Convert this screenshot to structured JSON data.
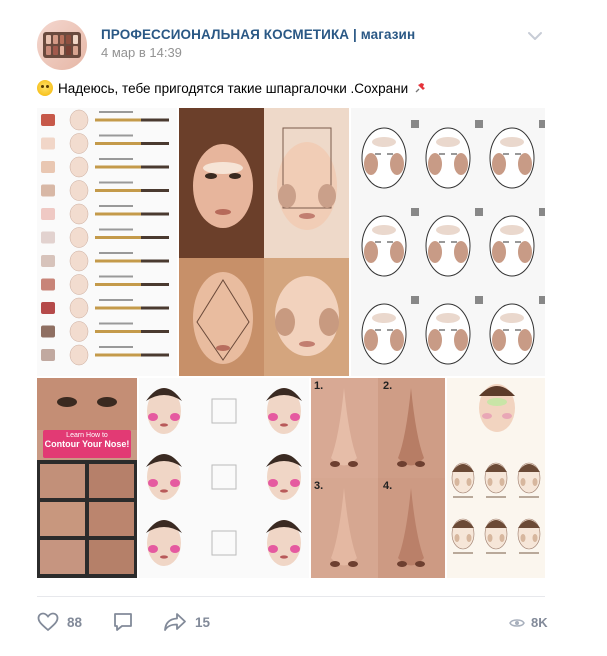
{
  "post": {
    "author": "ПРОФЕССИОНАЛЬНАЯ КОСМЕТИКА | магазин",
    "date": "4 мар в 14:39",
    "text": "Надеюсь, тебе пригодятся такие шпаргалочки .Сохрани",
    "emoji_start": "grinning-sweat-emoji",
    "emoji_end": "pushpin-emoji"
  },
  "photos": {
    "contour_nose_banner_line1": "Learn How to",
    "contour_nose_banner_line2": "Contour Your Nose!",
    "nose_steps": [
      "1.",
      "2.",
      "3.",
      "4."
    ]
  },
  "footer": {
    "likes": "88",
    "shares": "15",
    "views": "8K"
  },
  "colors": {
    "link": "#2a5885",
    "muted": "#828a99",
    "date": "#939393"
  }
}
